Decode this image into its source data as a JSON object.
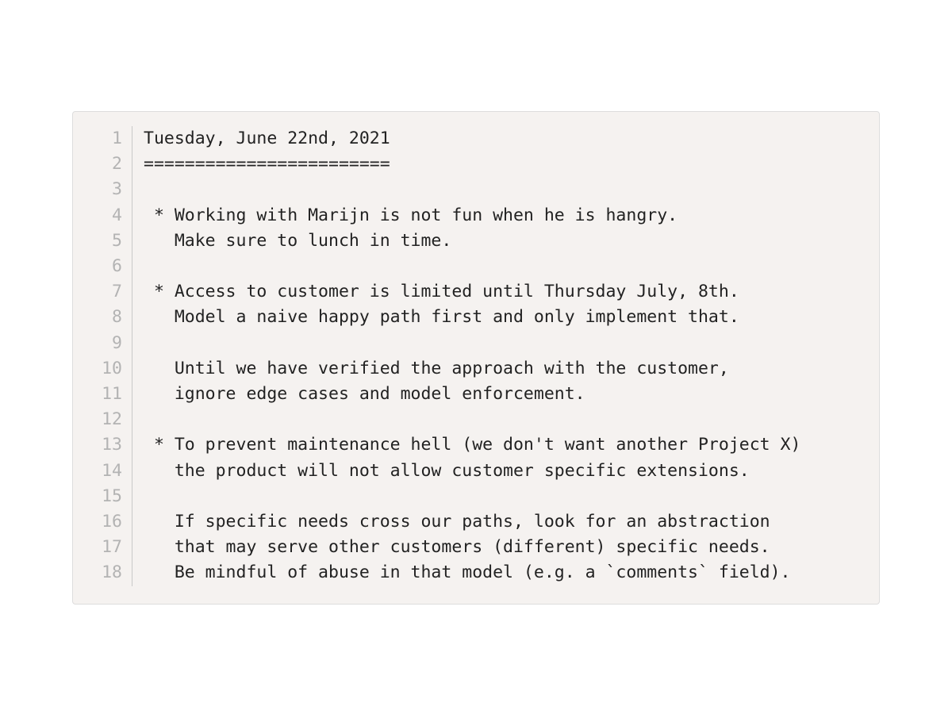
{
  "editor": {
    "lines": [
      {
        "num": "1",
        "text": "Tuesday, June 22nd, 2021"
      },
      {
        "num": "2",
        "text": "========================"
      },
      {
        "num": "3",
        "text": ""
      },
      {
        "num": "4",
        "text": " * Working with Marijn is not fun when he is hangry."
      },
      {
        "num": "5",
        "text": "   Make sure to lunch in time."
      },
      {
        "num": "6",
        "text": ""
      },
      {
        "num": "7",
        "text": " * Access to customer is limited until Thursday July, 8th."
      },
      {
        "num": "8",
        "text": "   Model a naive happy path first and only implement that."
      },
      {
        "num": "9",
        "text": ""
      },
      {
        "num": "10",
        "text": "   Until we have verified the approach with the customer,"
      },
      {
        "num": "11",
        "text": "   ignore edge cases and model enforcement."
      },
      {
        "num": "12",
        "text": ""
      },
      {
        "num": "13",
        "text": " * To prevent maintenance hell (we don't want another Project X)"
      },
      {
        "num": "14",
        "text": "   the product will not allow customer specific extensions."
      },
      {
        "num": "15",
        "text": ""
      },
      {
        "num": "16",
        "text": "   If specific needs cross our paths, look for an abstraction"
      },
      {
        "num": "17",
        "text": "   that may serve other customers (different) specific needs."
      },
      {
        "num": "18",
        "text": "   Be mindful of abuse in that model (e.g. a `comments` field)."
      }
    ]
  }
}
